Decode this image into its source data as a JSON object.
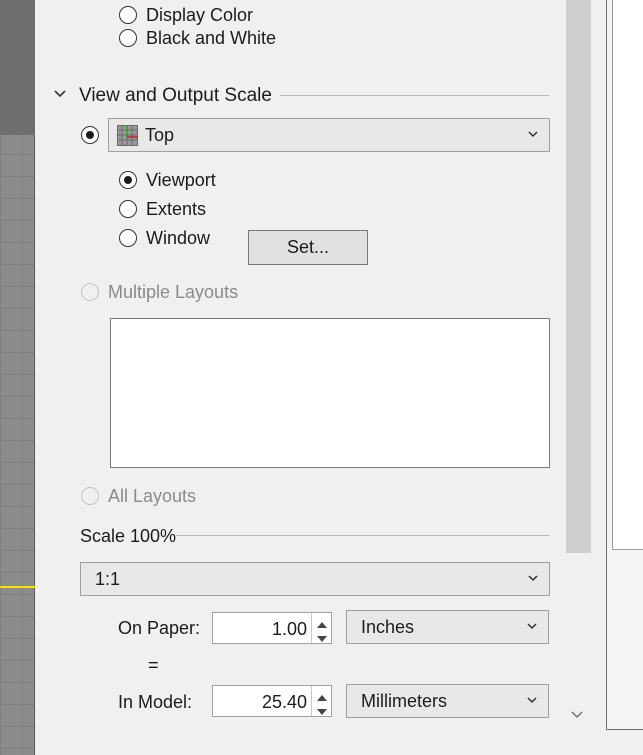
{
  "color_options": {
    "display_color": "Display Color",
    "black_and_white": "Black and White"
  },
  "section": {
    "title": "View and Output Scale"
  },
  "view_select": {
    "value": "Top"
  },
  "area_options": {
    "viewport": "Viewport",
    "extents": "Extents",
    "window": "Window"
  },
  "set_button": {
    "label": "Set..."
  },
  "layouts": {
    "multiple": "Multiple Layouts",
    "all": "All Layouts"
  },
  "scale": {
    "title": "Scale 100%",
    "ratio": "1:1"
  },
  "on_paper": {
    "label": "On Paper:",
    "value": "1.00",
    "unit": "Inches"
  },
  "equals": "=",
  "in_model": {
    "label": "In Model:",
    "value": "25.40",
    "unit": "Millimeters"
  },
  "colors": {
    "panel_bg": "#f0f0f0",
    "viewport_gray": "#8c8c8c",
    "yellow_axis": "#f2e600"
  }
}
